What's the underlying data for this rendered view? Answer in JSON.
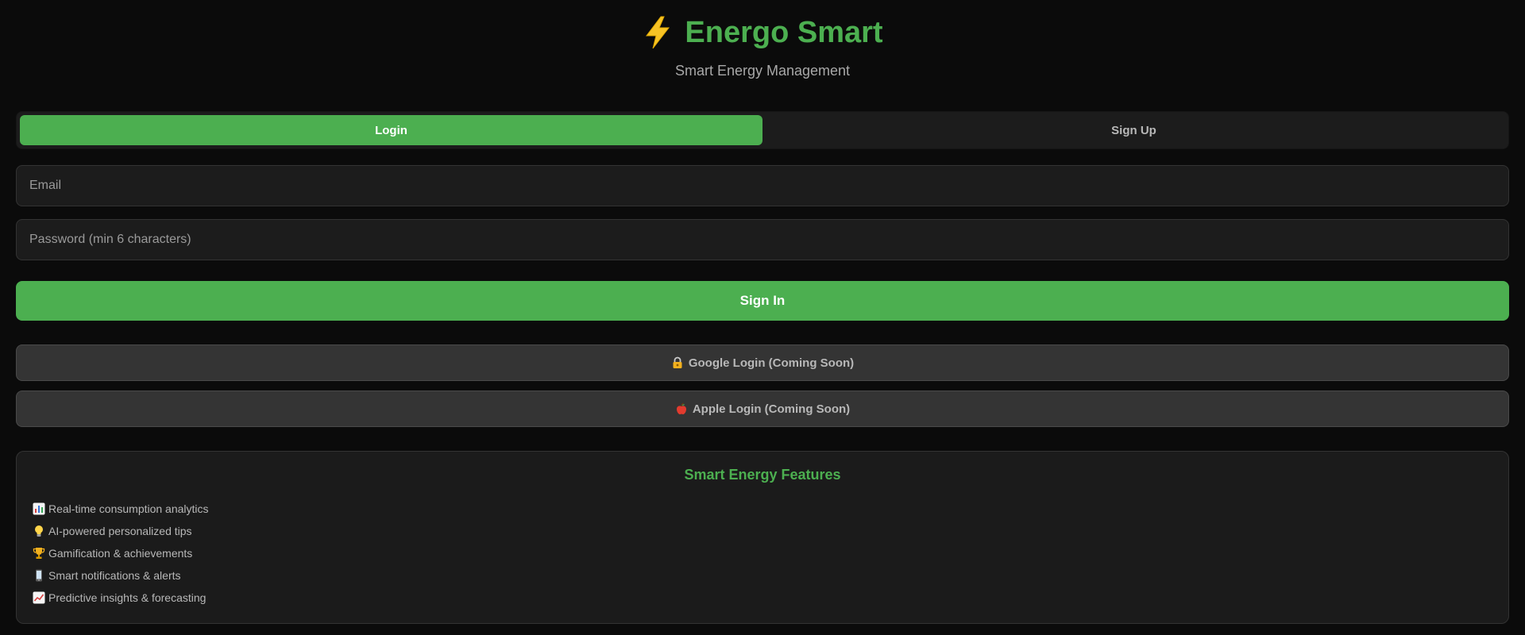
{
  "header": {
    "title": "Energo Smart",
    "subtitle": "Smart Energy Management",
    "icon": "lightning-bolt-icon"
  },
  "tabs": [
    {
      "label": "Login",
      "active": true
    },
    {
      "label": "Sign Up",
      "active": false
    }
  ],
  "form": {
    "email_placeholder": "Email",
    "email_value": "",
    "password_placeholder": "Password (min 6 characters)",
    "password_value": "",
    "submit_label": "Sign In"
  },
  "social": [
    {
      "label": "Google Login (Coming Soon)",
      "icon": "lock-key-icon"
    },
    {
      "label": "Apple Login (Coming Soon)",
      "icon": "apple-icon"
    }
  ],
  "features": {
    "title": "Smart Energy Features",
    "items": [
      {
        "label": "Real-time consumption analytics",
        "icon": "bar-chart-icon"
      },
      {
        "label": "AI-powered personalized tips",
        "icon": "light-bulb-icon"
      },
      {
        "label": "Gamification & achievements",
        "icon": "trophy-icon"
      },
      {
        "label": "Smart notifications & alerts",
        "icon": "mobile-phone-icon"
      },
      {
        "label": "Predictive insights & forecasting",
        "icon": "trending-up-icon"
      }
    ]
  },
  "colors": {
    "accent": "#4caf50",
    "background": "#0b0b0b",
    "surface": "#1c1c1c",
    "secondary_button": "#343434"
  }
}
